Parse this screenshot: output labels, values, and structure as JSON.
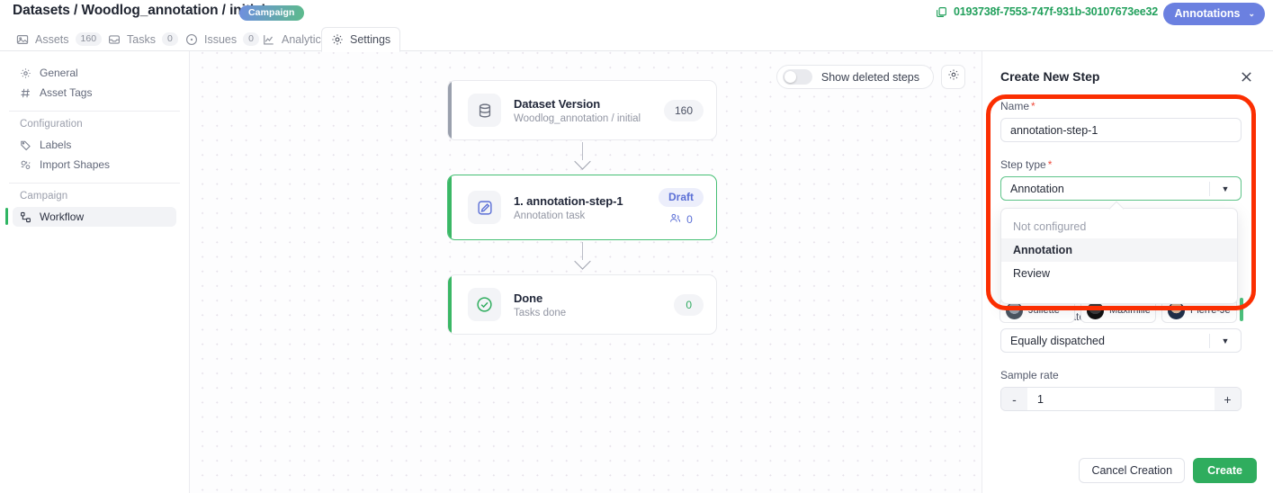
{
  "topbar": {
    "breadcrumb": "Datasets / Woodlog_annotation / initial",
    "campaign_badge": "Campaign",
    "dataset_id": "0193738f-7553-747f-931b-30107673ee32",
    "dataset_id_color": "#22a05c",
    "annotations_button": "Annotations",
    "annotations_chevron": "⌄",
    "annotations_color": "#6b80e0"
  },
  "tabs": [
    {
      "label": "Assets",
      "count": "160",
      "icon": "image-icon",
      "active": false
    },
    {
      "label": "Tasks",
      "count": "0",
      "icon": "inbox-icon",
      "active": false
    },
    {
      "label": "Issues",
      "count": "0",
      "icon": "issue-icon",
      "active": false
    },
    {
      "label": "Analytics",
      "count": "",
      "icon": "chart-icon",
      "active": false
    },
    {
      "label": "Settings",
      "count": "",
      "icon": "gear-icon",
      "active": true
    }
  ],
  "sidebar": {
    "items_top": [
      {
        "label": "General",
        "icon": "gear-icon"
      },
      {
        "label": "Asset Tags",
        "icon": "hash-icon"
      }
    ],
    "group_configuration": "Configuration",
    "items_config": [
      {
        "label": "Labels",
        "icon": "tag-icon"
      },
      {
        "label": "Import Shapes",
        "icon": "shapes-icon"
      }
    ],
    "group_campaign": "Campaign",
    "items_campaign": [
      {
        "label": "Workflow",
        "icon": "workflow-icon",
        "active": true
      }
    ]
  },
  "canvas": {
    "show_deleted_label": "Show deleted steps",
    "show_deleted_on": false,
    "settings_icon": "gear-icon",
    "steps": [
      {
        "title": "Dataset Version",
        "subtitle": "Woodlog_annotation / initial",
        "icon": "database-icon",
        "count": "160",
        "accent": "#9aa0ad",
        "badge": "",
        "assignees": ""
      },
      {
        "title": "1. annotation-step-1",
        "subtitle": "Annotation task",
        "icon": "edit-square-icon",
        "count": "",
        "accent": "#3ab765",
        "badge": "Draft",
        "assignees": "0"
      },
      {
        "title": "Done",
        "subtitle": "Tasks done",
        "icon": "check-circle-icon",
        "count": "0",
        "accent": "#3ab765",
        "badge": "",
        "assignees": ""
      }
    ]
  },
  "panel": {
    "title": "Create New Step",
    "close_icon": "close-icon",
    "name_label": "Name",
    "name_value": "annotation-step-1",
    "step_type_label": "Step type",
    "step_type_value": "Annotation",
    "step_type_options": [
      {
        "label": "Not configured",
        "state": "placeholder"
      },
      {
        "label": "Annotation",
        "state": "selected"
      },
      {
        "label": "Review",
        "state": "normal"
      }
    ],
    "assignee_chips": [
      {
        "name": "Juliette"
      },
      {
        "name": "Maximilie"
      },
      {
        "name": "Pierre-Jea"
      }
    ],
    "split_label": "Assets split strategy",
    "split_value": "Equally dispatched",
    "sample_rate_label": "Sample rate",
    "sample_rate_value": "1",
    "sample_minus": "-",
    "sample_plus": "+",
    "cancel_label": "Cancel Creation",
    "create_label": "Create",
    "create_color": "#2fad5e"
  }
}
